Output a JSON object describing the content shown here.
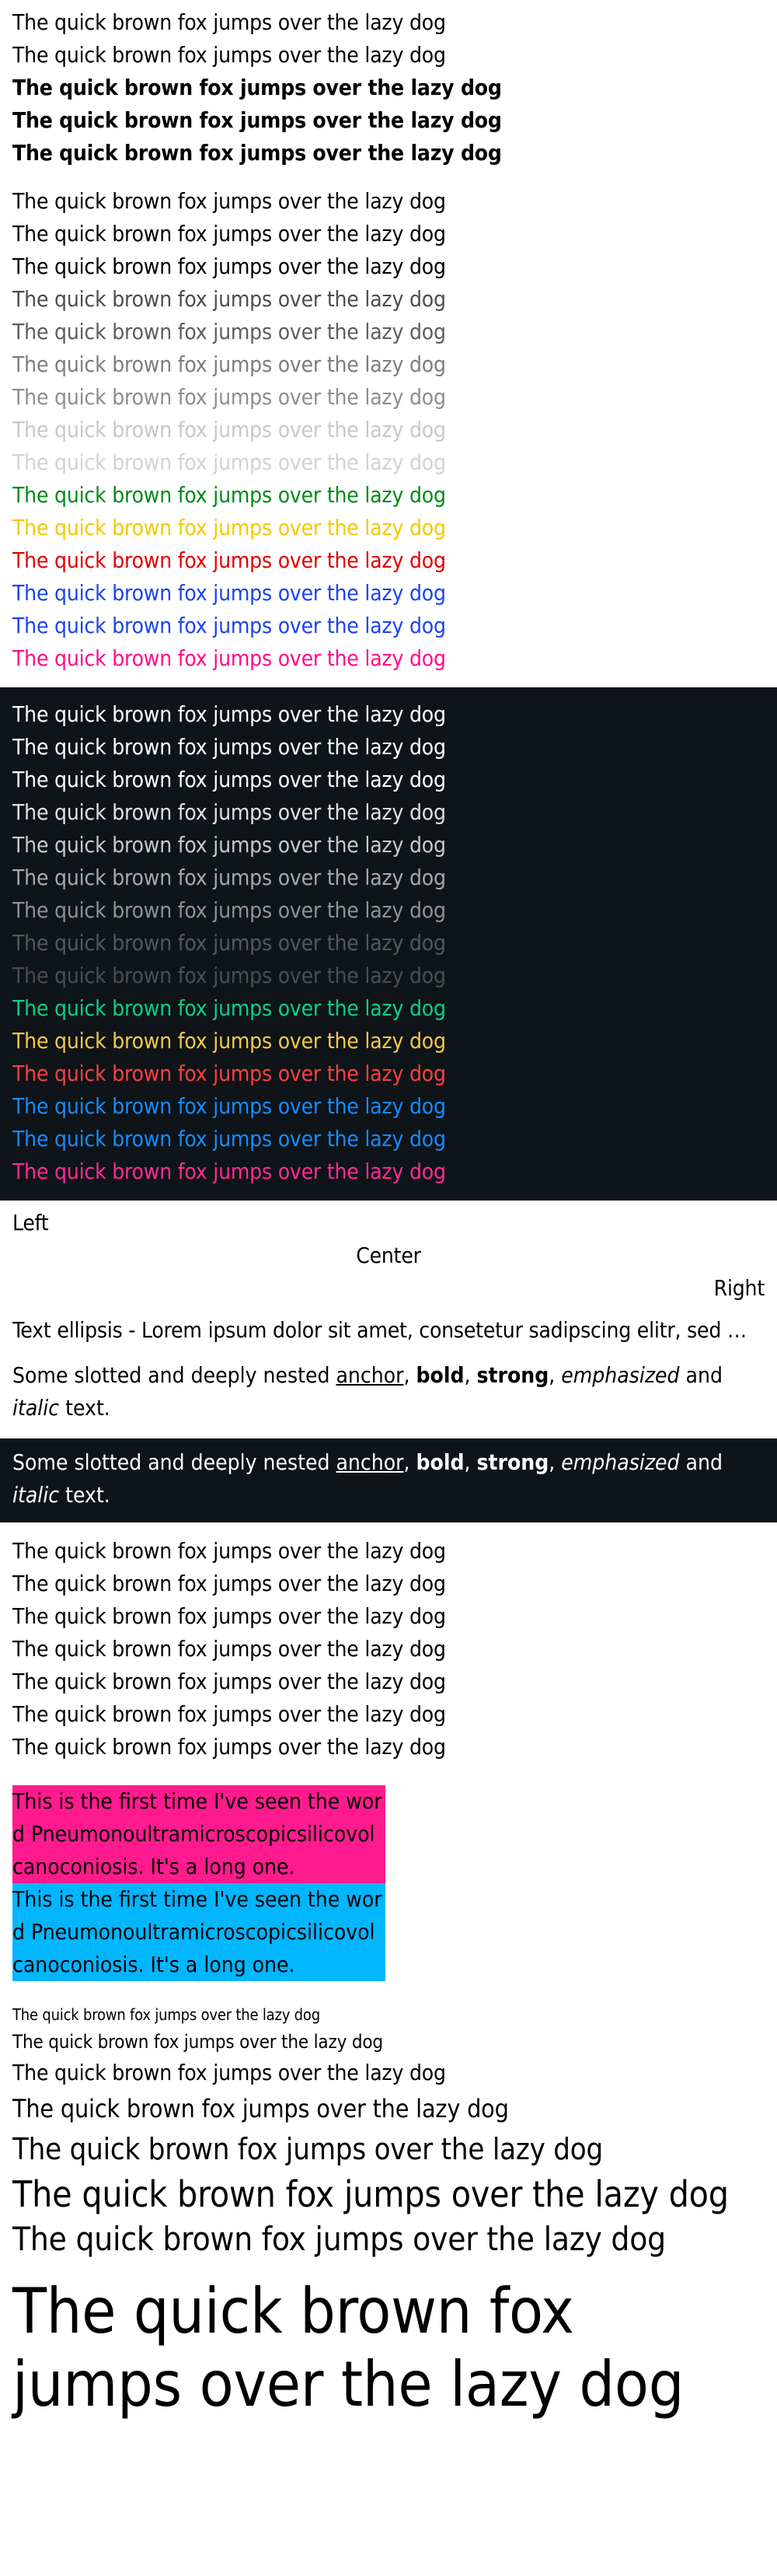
{
  "sample_text": "The quick brown fox jumps over the lazy dog",
  "weights": [
    {
      "text": "The quick brown fox jumps over the lazy dog",
      "weight": "regular"
    },
    {
      "text": "The quick brown fox jumps over the lazy dog",
      "weight": "regular"
    },
    {
      "text": "The quick brown fox jumps over the lazy dog",
      "weight": "semibold"
    },
    {
      "text": "The quick brown fox jumps over the lazy dog",
      "weight": "semibold"
    },
    {
      "text": "The quick brown fox jumps over the lazy dog",
      "weight": "bold"
    }
  ],
  "colors_light": [
    {
      "text": "The quick brown fox jumps over the lazy dog",
      "color": "#000000"
    },
    {
      "text": "The quick brown fox jumps over the lazy dog",
      "color": "#000000"
    },
    {
      "text": "The quick brown fox jumps over the lazy dog",
      "color": "#000000"
    },
    {
      "text": "The quick brown fox jumps over the lazy dog",
      "color": "#4a4e52"
    },
    {
      "text": "The quick brown fox jumps over the lazy dog",
      "color": "#5a5e62"
    },
    {
      "text": "The quick brown fox jumps over the lazy dog",
      "color": "#7a7e82"
    },
    {
      "text": "The quick brown fox jumps over the lazy dog",
      "color": "#8a8e92"
    },
    {
      "text": "The quick brown fox jumps over the lazy dog",
      "color": "#c6c8ca"
    },
    {
      "text": "The quick brown fox jumps over the lazy dog",
      "color": "#d0d2d4"
    },
    {
      "text": "The quick brown fox jumps over the lazy dog",
      "color": "#018a16"
    },
    {
      "text": "The quick brown fox jumps over the lazy dog",
      "color": "#f5c800"
    },
    {
      "text": "The quick brown fox jumps over the lazy dog",
      "color": "#e00000"
    },
    {
      "text": "The quick brown fox jumps over the lazy dog",
      "color": "#1a44ea"
    },
    {
      "text": "The quick brown fox jumps over the lazy dog",
      "color": "#1a44ea"
    },
    {
      "text": "The quick brown fox jumps over the lazy dog",
      "color": "#ff0a8a"
    }
  ],
  "colors_dark": [
    {
      "text": "The quick brown fox jumps over the lazy dog",
      "color": "#ffffff"
    },
    {
      "text": "The quick brown fox jumps over the lazy dog",
      "color": "#ffffff"
    },
    {
      "text": "The quick brown fox jumps over the lazy dog",
      "color": "#ffffff"
    },
    {
      "text": "The quick brown fox jumps over the lazy dog",
      "color": "#e1e2e3"
    },
    {
      "text": "The quick brown fox jumps over the lazy dog",
      "color": "#c8cacb"
    },
    {
      "text": "The quick brown fox jumps over the lazy dog",
      "color": "#a7a9ab"
    },
    {
      "text": "The quick brown fox jumps over the lazy dog",
      "color": "#8f9294"
    },
    {
      "text": "The quick brown fox jumps over the lazy dog",
      "color": "#55585b"
    },
    {
      "text": "The quick brown fox jumps over the lazy dog",
      "color": "#4b4e51"
    },
    {
      "text": "The quick brown fox jumps over the lazy dog",
      "color": "#09d087"
    },
    {
      "text": "The quick brown fox jumps over the lazy dog",
      "color": "#f5c84c"
    },
    {
      "text": "The quick brown fox jumps over the lazy dog",
      "color": "#fc4040"
    },
    {
      "text": "The quick brown fox jumps over the lazy dog",
      "color": "#178bff"
    },
    {
      "text": "The quick brown fox jumps over the lazy dog",
      "color": "#178bff"
    },
    {
      "text": "The quick brown fox jumps over the lazy dog",
      "color": "#ff2b95"
    }
  ],
  "alignment": {
    "left": "Left",
    "center": "Center",
    "right": "Right"
  },
  "ellipsis_text": "Text ellipsis - Lorem ipsum dolor sit amet, consetetur sadipscing elitr, sed diam nonumy eirmod tempor invidunt ut labore et dolore magna aliquyam erat",
  "rich_text": {
    "prefix": "Some slotted and deeply nested ",
    "anchor": "anchor",
    "sep1": ", ",
    "bold": "bold",
    "sep2": ", ",
    "strong": "strong",
    "sep3": ", ",
    "emphasized": "emphasized",
    "sep4": " and ",
    "italic": "italic",
    "suffix": " text."
  },
  "repeated": [
    "The quick brown fox jumps over the lazy dog",
    "The quick brown fox jumps over the lazy dog",
    "The quick brown fox jumps over the lazy dog",
    "The quick brown fox jumps over the lazy dog",
    "The quick brown fox jumps over the lazy dog",
    "The quick brown fox jumps over the lazy dog",
    "The quick brown fox jumps over the lazy dog"
  ],
  "hyphenation": {
    "text": "This is the first time I've seen the word Pneumonoultramicroscopicsilicovolcanoconiosis. It's a long one.",
    "colors": [
      "#ff1b8d",
      "#00b6ff"
    ]
  },
  "sizes": [
    "The quick brown fox jumps over the lazy dog",
    "The quick brown fox jumps over the lazy dog",
    "The quick brown fox jumps over the lazy dog",
    "The quick brown fox jumps over the lazy dog",
    "The quick brown fox jumps over the lazy dog",
    "The quick brown fox jumps over the lazy dog",
    "The quick brown fox jumps over the lazy dog",
    "The quick brown fox jumps over the lazy dog"
  ]
}
